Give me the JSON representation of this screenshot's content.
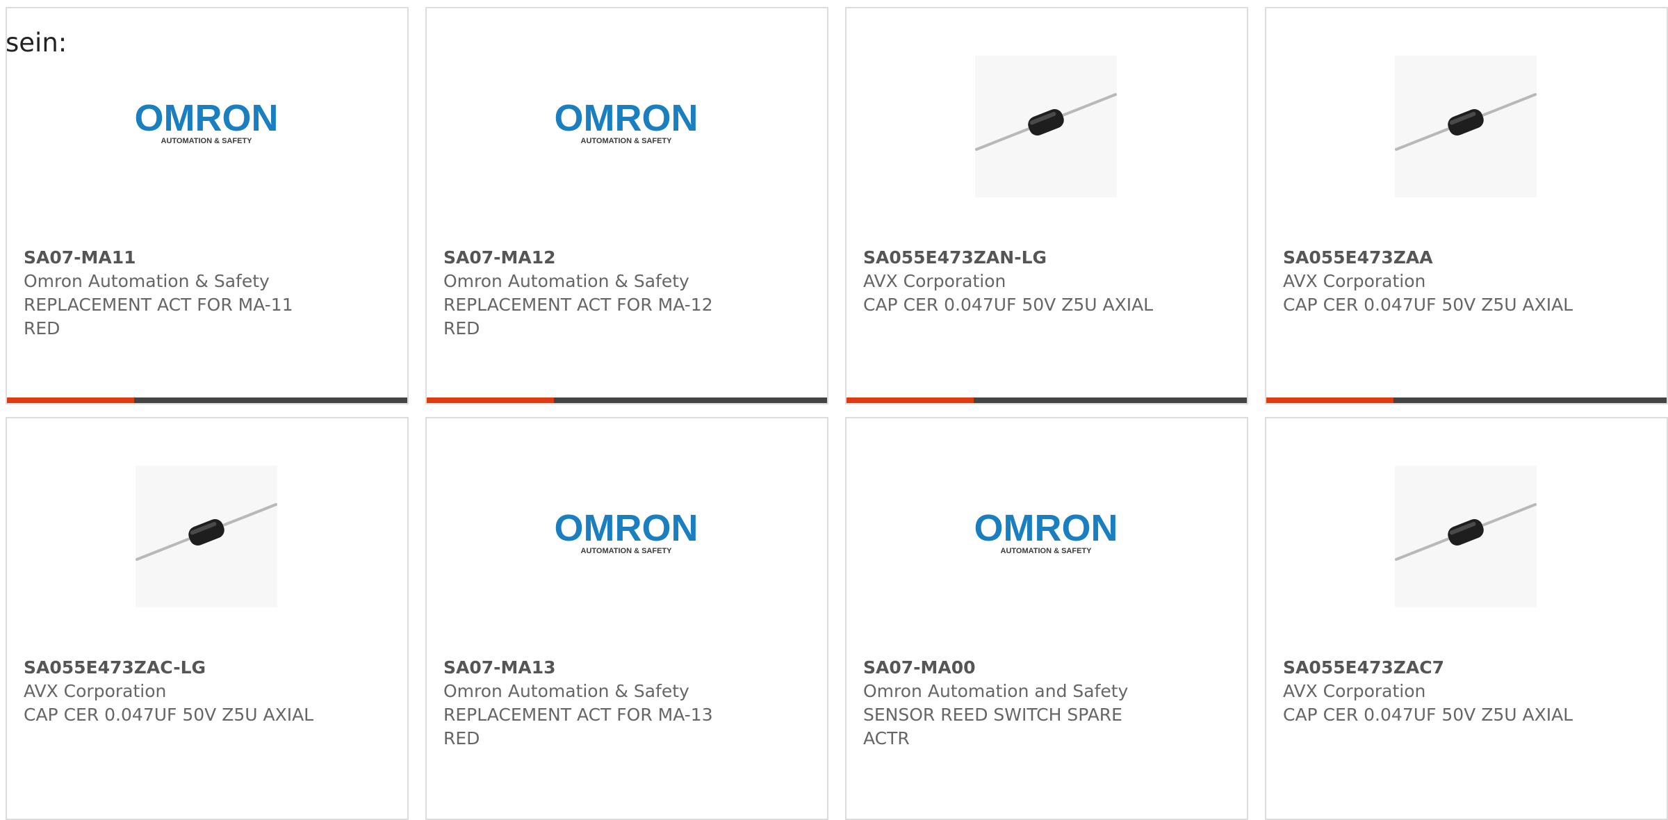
{
  "intro_text": "sein:",
  "colors": {
    "accent": "#e03a12",
    "bar": "#444444",
    "omron_blue": "#1a7fc1",
    "text": "#666666"
  },
  "products": [
    {
      "part_number": "SA07-MA11",
      "manufacturer": "Omron Automation & Safety",
      "description": "REPLACEMENT ACT FOR MA-11 RED",
      "image": "omron-logo",
      "logo_word": "OMRON",
      "logo_tagline": "AUTOMATION & SAFETY"
    },
    {
      "part_number": "SA07-MA12",
      "manufacturer": "Omron Automation & Safety",
      "description": "REPLACEMENT ACT FOR MA-12 RED",
      "image": "omron-logo",
      "logo_word": "OMRON",
      "logo_tagline": "AUTOMATION & SAFETY"
    },
    {
      "part_number": "SA055E473ZAN-LG",
      "manufacturer": "AVX Corporation",
      "description": "CAP CER 0.047UF 50V Z5U AXIAL",
      "image": "axial-capacitor"
    },
    {
      "part_number": "SA055E473ZAA",
      "manufacturer": "AVX Corporation",
      "description": "CAP CER 0.047UF 50V Z5U AXIAL",
      "image": "axial-capacitor"
    },
    {
      "part_number": "SA055E473ZAC-LG",
      "manufacturer": "AVX Corporation",
      "description": "CAP CER 0.047UF 50V Z5U AXIAL",
      "image": "axial-capacitor"
    },
    {
      "part_number": "SA07-MA13",
      "manufacturer": "Omron Automation & Safety",
      "description": "REPLACEMENT ACT FOR MA-13 RED",
      "image": "omron-logo",
      "logo_word": "OMRON",
      "logo_tagline": "AUTOMATION & SAFETY"
    },
    {
      "part_number": "SA07-MA00",
      "manufacturer": "Omron Automation and Safety",
      "description": "SENSOR REED SWITCH SPARE ACTR",
      "image": "omron-logo",
      "logo_word": "OMRON",
      "logo_tagline": "AUTOMATION & SAFETY"
    },
    {
      "part_number": "SA055E473ZAC7",
      "manufacturer": "AVX Corporation",
      "description": "CAP CER 0.047UF 50V Z5U AXIAL",
      "image": "axial-capacitor"
    }
  ]
}
